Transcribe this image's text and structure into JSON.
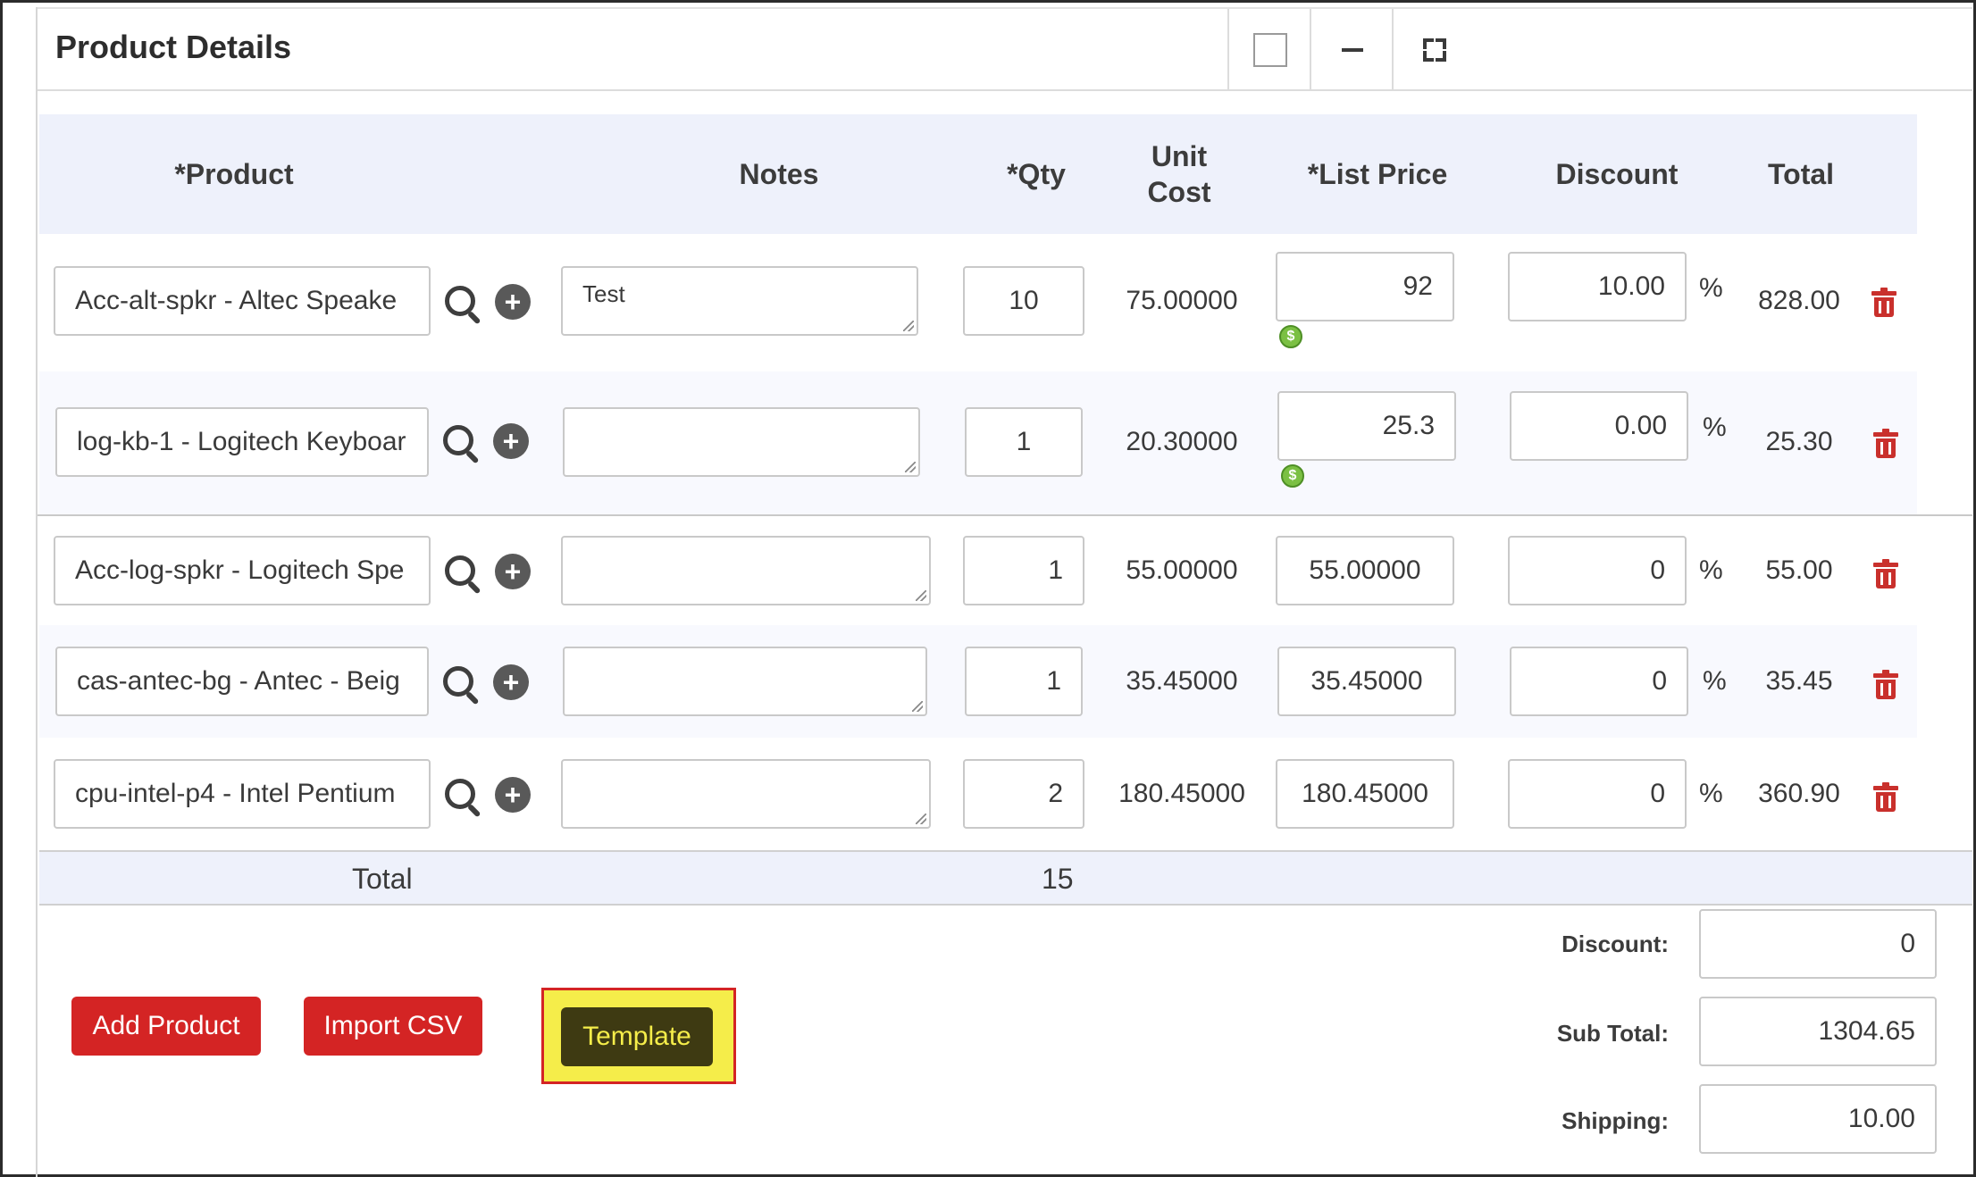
{
  "panel": {
    "title": "Product Details"
  },
  "columns": {
    "product": "*Product",
    "notes": "Notes",
    "qty": "*Qty",
    "unit_cost_1": "Unit",
    "unit_cost_2": "Cost",
    "list_price": "*List Price",
    "discount": "Discount",
    "total": "Total"
  },
  "rows": [
    {
      "product": "Acc-alt-spkr - Altec Speake",
      "notes": "Test",
      "qty": "10",
      "unit_cost": "75.00000",
      "list_price": "92",
      "discount": "10.00",
      "pct": "%",
      "total": "828.00"
    },
    {
      "product": "log-kb-1 - Logitech Keyboar",
      "notes": "",
      "qty": "1",
      "unit_cost": "20.30000",
      "list_price": "25.3",
      "discount": "0.00",
      "pct": "%",
      "total": "25.30"
    },
    {
      "product": "Acc-log-spkr - Logitech Spe",
      "notes": "",
      "qty": "1",
      "unit_cost": "55.00000",
      "list_price": "55.00000",
      "discount": "0",
      "pct": "%",
      "total": "55.00"
    },
    {
      "product": "cas-antec-bg - Antec - Beig",
      "notes": "",
      "qty": "1",
      "unit_cost": "35.45000",
      "list_price": "35.45000",
      "discount": "0",
      "pct": "%",
      "total": "35.45"
    },
    {
      "product": "cpu-intel-p4 - Intel Pentium",
      "notes": "",
      "qty": "2",
      "unit_cost": "180.45000",
      "list_price": "180.45000",
      "discount": "0",
      "pct": "%",
      "total": "360.90"
    }
  ],
  "totals": {
    "label": "Total",
    "qty": "15"
  },
  "summary": {
    "discount_label": "Discount:",
    "discount_value": "0",
    "subtotal_label": "Sub Total:",
    "subtotal_value": "1304.65",
    "shipping_label": "Shipping:",
    "shipping_value": "10.00"
  },
  "buttons": {
    "add_product": "Add Product",
    "import_csv": "Import CSV",
    "template": "Template"
  },
  "icons": {
    "search": "search-icon",
    "add": "plus-circle-icon",
    "delete": "trash-icon",
    "price_book": "money-icon"
  },
  "colors": {
    "danger": "#d42424",
    "header_bg": "#eef1fb",
    "highlight": "#f5ed4a"
  }
}
